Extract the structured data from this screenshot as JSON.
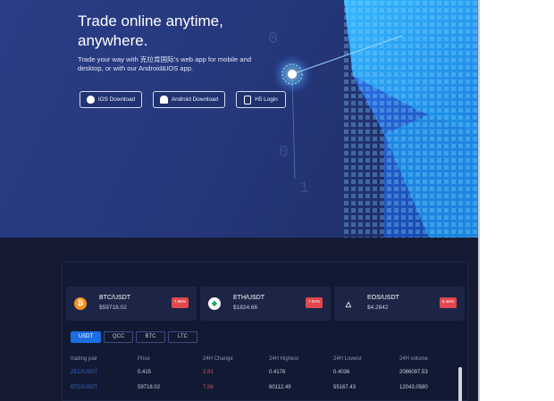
{
  "hero": {
    "title": "Trade online anytime, anywhere.",
    "description": "Trade your way with 克拉肯国际's web app for mobile and desktop, or with our Android&IOS app.",
    "buttons": {
      "ios": "IOS Download",
      "android": "Android Download",
      "h5": "H5 Login"
    }
  },
  "tickers": [
    {
      "pair": "BTC/USDT",
      "price": "$59718.02",
      "change": "7.96%"
    },
    {
      "pair": "ETH/USDT",
      "price": "$1824.66",
      "change": "7.02%"
    },
    {
      "pair": "EOS/USDT",
      "price": "$4.2842",
      "change": "6.36%"
    }
  ],
  "tabs": [
    "USDT",
    "QCC",
    "BTC",
    "LTC"
  ],
  "table": {
    "headers": [
      "trading pair",
      "Price",
      "24H Change",
      "24H Highest",
      "24H Lowest",
      "24H volume"
    ],
    "rows": [
      [
        "ZEC/USDT",
        "0.415",
        "2.83",
        "0.4176",
        "0.4036",
        "2086097.53"
      ],
      [
        "BTC/USDT",
        "59718.02",
        "7.96",
        "60112.49",
        "55167.43",
        "12043.0580"
      ]
    ]
  },
  "icons": {
    "ios": "apple-icon",
    "android": "android-icon",
    "h5": "shield-icon",
    "btc": "bitcoin-icon",
    "eth": "ethereum-icon",
    "eos": "eos-icon"
  },
  "colors": {
    "page_bg": "#141b33",
    "hero_bg": "#2a3d86",
    "accent": "#1c6de0",
    "negative": "#e0484e",
    "card_bg": "#1d2546"
  }
}
